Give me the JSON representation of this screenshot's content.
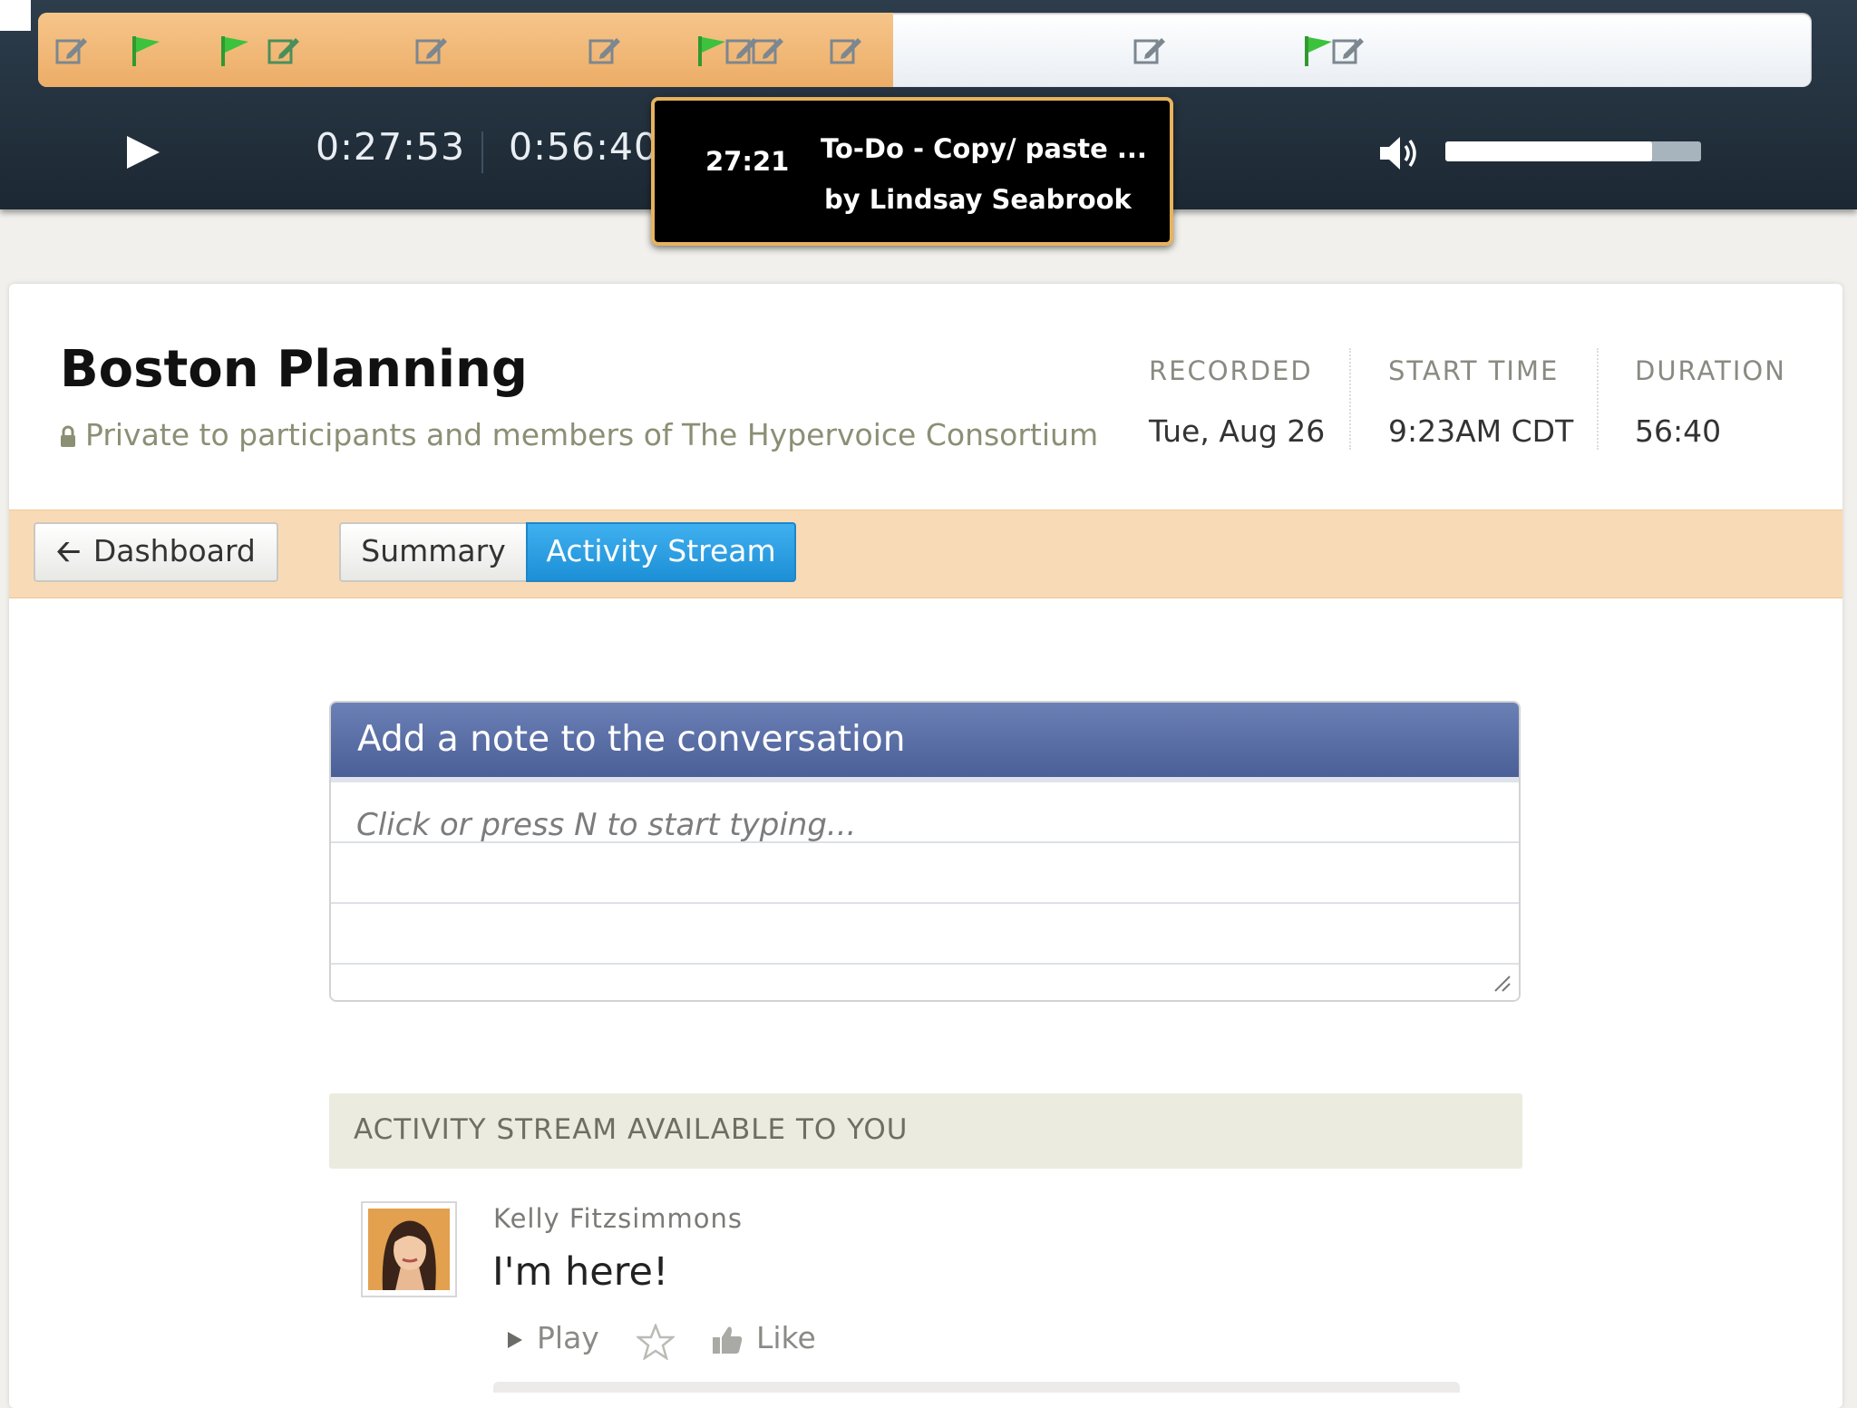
{
  "player": {
    "current_time": "0:27:53",
    "total_time": "0:56:40",
    "progress": 0.482,
    "volume": 0.81,
    "markers": [
      {
        "type": "note",
        "pos": 0.009
      },
      {
        "type": "flag",
        "pos": 0.051
      },
      {
        "type": "flag",
        "pos": 0.101
      },
      {
        "type": "note-green",
        "pos": 0.129
      },
      {
        "type": "note",
        "pos": 0.212
      },
      {
        "type": "note",
        "pos": 0.31
      },
      {
        "type": "flag",
        "pos": 0.37
      },
      {
        "type": "note",
        "pos": 0.387
      },
      {
        "type": "note",
        "pos": 0.402
      },
      {
        "type": "note",
        "pos": 0.446
      },
      {
        "type": "note",
        "pos": 0.617
      },
      {
        "type": "flag",
        "pos": 0.712
      },
      {
        "type": "note",
        "pos": 0.729
      }
    ],
    "tooltip": {
      "time": "27:21",
      "title": "To-Do - Copy/ paste ...",
      "author": "by Lindsay Seabrook"
    }
  },
  "meeting": {
    "title": "Boston Planning",
    "privacy": "Private to participants and members of The Hypervoice Consortium",
    "meta": [
      {
        "label": "RECORDED",
        "value": "Tue, Aug 26"
      },
      {
        "label": "START TIME",
        "value": "9:23AM CDT"
      },
      {
        "label": "DURATION",
        "value": "56:40"
      }
    ]
  },
  "nav": {
    "dashboard": "Dashboard",
    "tabs": [
      {
        "label": "Summary",
        "active": false
      },
      {
        "label": "Activity Stream",
        "active": true
      }
    ]
  },
  "note": {
    "title": "Add a note to the conversation",
    "placeholder": "Click or press N to start typing..."
  },
  "stream": {
    "header": "ACTIVITY STREAM AVAILABLE TO YOU",
    "items": [
      {
        "author": "Kelly Fitzsimmons",
        "text": "I'm here!",
        "actions": {
          "play": "Play",
          "like": "Like"
        }
      }
    ]
  },
  "colors": {
    "accent_blue": "#2a9ee3",
    "timeline_orange": "#f1b875",
    "flag_green": "#3cc23c",
    "tooltip_border": "#e8b25e",
    "tabbar": "#f8dbb6"
  },
  "icons": [
    "play-icon",
    "stop-icon",
    "volume-icon",
    "note-icon",
    "flag-icon",
    "lock-icon",
    "arrow-left-icon",
    "star-icon",
    "thumbs-up-icon"
  ]
}
